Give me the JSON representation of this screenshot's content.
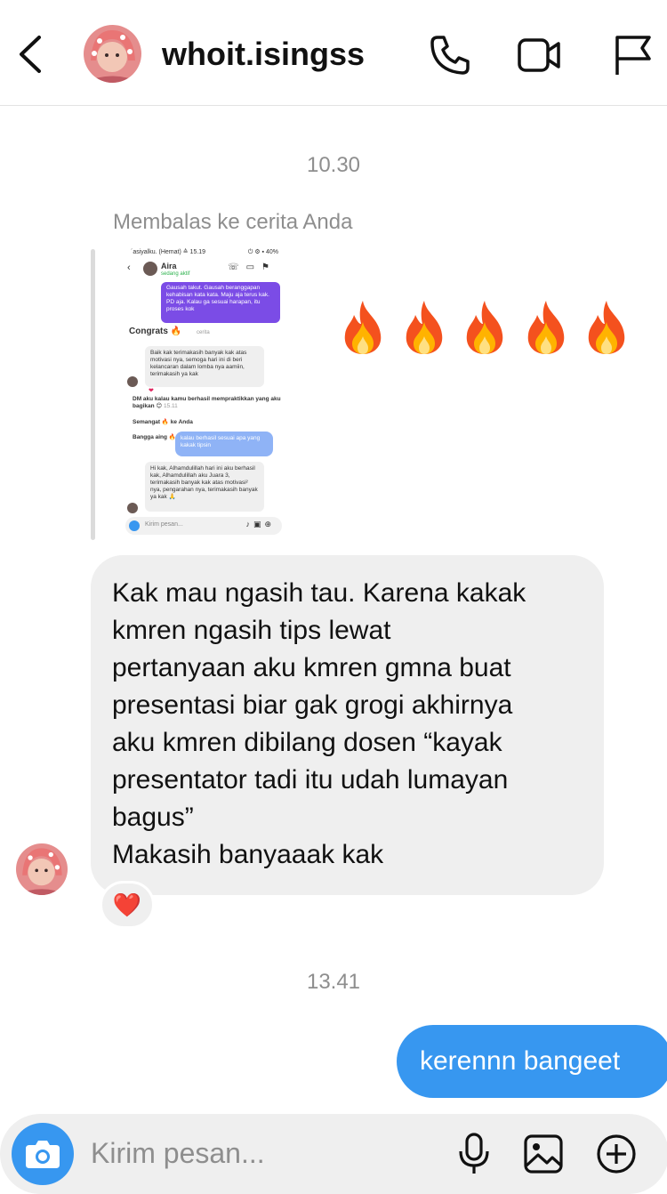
{
  "header": {
    "username": "whoit.isingss",
    "icons": [
      "back-chevron-icon",
      "phone-icon",
      "video-camera-icon",
      "flag-icon"
    ]
  },
  "timestamps": {
    "first": "10.30",
    "second": "13.41"
  },
  "story_reply": {
    "label": "Membalas ke cerita Anda",
    "screenshot": {
      "status_left": "´asiyalku. (Hemat) ≙ 15.19",
      "status_right": "⏻ ⚙ ▪ 40%",
      "contact_name": "Aira",
      "contact_sub": "sedang aktif",
      "purple_msg": "Gausah takut. Gausah beranggapan kehabisan kata kata. Maju aja terus kak. PD aja. Kalau ga sesuai harapan, itu proses kok",
      "congrats": "Congrats 🔥",
      "congrats_time": "cerita",
      "gray_msg_1": "Baik kak terimakasih banyak kak atas motivasi nya, semoga hari ini di beri kelancaran dalam lomba nya aamiin, terimakasih ya kak",
      "bold_line": "DM aku kalau kamu berhasil mempraktikkan yang aku bagikan 😊",
      "bold_time": "15.11",
      "semangat": "Semangat 🔥 ke Anda",
      "bangga": "Bangga aing 🔥",
      "blue_msg": "kalau berhasil sesuai apa yang kakak tipsin",
      "gray_msg_2": "Hi kak, Alhamdulillah hari ini aku berhasil kak, Alhamdulillah aku Juara 3, terimakasih banyak kak atas motivasi² nya, pengarahan nya, terimakasih banyak ya kak 🙏",
      "input_placeholder": "Kirim pesan..."
    },
    "reaction_emojis": [
      "fire",
      "fire",
      "fire",
      "fire",
      "fire"
    ]
  },
  "incoming_message": {
    "text": "Kak mau ngasih tau. Karena kakak\nkmren ngasih tips lewat\npertanyaan aku kmren gmna buat\npresentasi biar gak grogi akhirnya\naku kmren dibilang dosen “kayak\npresentator tadi itu udah lumayan\nbagus”\nMakasih banyaaak kak",
    "reaction": "❤️"
  },
  "outgoing_message": {
    "text": "kerennn bangeet"
  },
  "composer": {
    "placeholder": "Kirim pesan..."
  },
  "colors": {
    "accent_blue": "#3797f0",
    "bubble_gray": "#efefef",
    "story_purple": "#7b4ce6"
  }
}
